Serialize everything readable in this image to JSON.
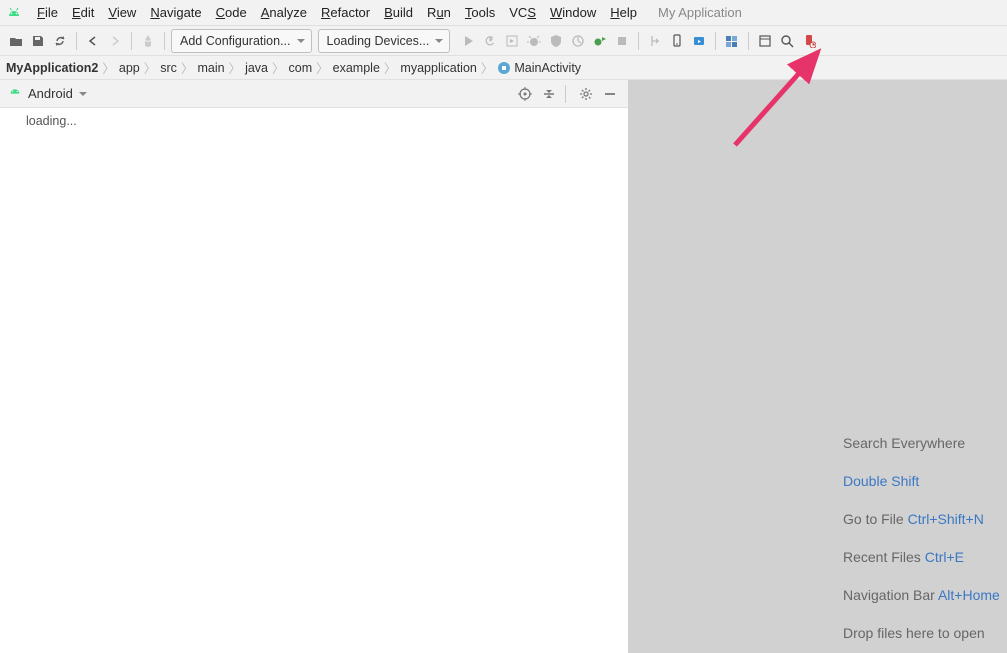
{
  "menu": {
    "items": [
      "File",
      "Edit",
      "View",
      "Navigate",
      "Code",
      "Analyze",
      "Refactor",
      "Build",
      "Run",
      "Tools",
      "VCS",
      "Window",
      "Help"
    ],
    "underlines": [
      "F",
      "E",
      "V",
      "N",
      "C",
      "A",
      "R",
      "B",
      "R",
      "T",
      "S",
      "W",
      "H"
    ],
    "project": "My Application"
  },
  "toolbar": {
    "config_label": "Add Configuration...",
    "devices_label": "Loading Devices..."
  },
  "breadcrumb": {
    "items": [
      "MyApplication2",
      "app",
      "src",
      "main",
      "java",
      "com",
      "example",
      "myapplication",
      "MainActivity"
    ]
  },
  "panel": {
    "title": "Android",
    "loading": "loading..."
  },
  "hints": {
    "l1a": "Search Everywhere ",
    "l1b": "Double Shift",
    "l2a": "Go to File ",
    "l2b": "Ctrl+Shift+N",
    "l3a": "Recent Files ",
    "l3b": "Ctrl+E",
    "l4a": "Navigation Bar ",
    "l4b": "Alt+Home",
    "l5": "Drop files here to open"
  }
}
